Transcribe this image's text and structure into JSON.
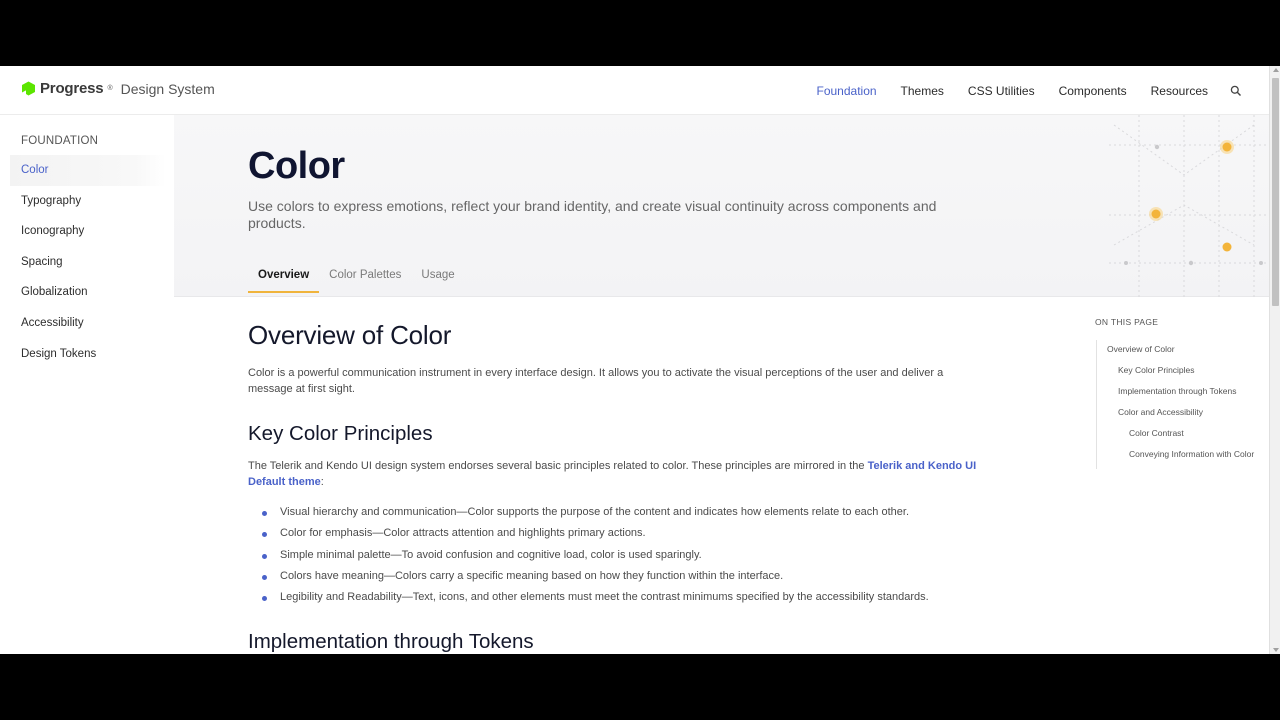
{
  "header": {
    "brand_name": "Progress",
    "brand_reg": "®",
    "brand_sub": "Design System",
    "nav": [
      "Foundation",
      "Themes",
      "CSS Utilities",
      "Components",
      "Resources"
    ],
    "active_nav": "Foundation",
    "search_icon": "search-icon"
  },
  "sidebar": {
    "heading": "FOUNDATION",
    "items": [
      "Color",
      "Typography",
      "Iconography",
      "Spacing",
      "Globalization",
      "Accessibility",
      "Design Tokens"
    ],
    "active_item": "Color"
  },
  "hero": {
    "title": "Color",
    "subtitle": "Use colors to express emotions, reflect your brand identity, and create visual continuity across components and products.",
    "tabs": [
      "Overview",
      "Color Palettes",
      "Usage"
    ],
    "active_tab": "Overview"
  },
  "content": {
    "h1": "Overview of Color",
    "intro": "Color is a powerful communication instrument in every interface design. It allows you to activate the visual perceptions of the user and deliver a message at first sight.",
    "section1_title": "Key Color Principles",
    "section1_text_before": "The Telerik and Kendo UI design system endorses several basic principles related to color. These principles are mirrored in the ",
    "section1_link": "Telerik and Kendo UI Default theme",
    "section1_text_after": ":",
    "principles": [
      "Visual hierarchy and communication—Color supports the purpose of the content and indicates how elements relate to each other.",
      "Color for emphasis—Color attracts attention and highlights primary actions.",
      "Simple minimal palette—To avoid confusion and cognitive load, color is used sparingly.",
      "Colors have meaning—Colors carry a specific meaning based on how they function within the interface.",
      "Legibility and Readability—Text, icons, and other elements must meet the contrast minimums specified by the accessibility standards."
    ],
    "section2_title": "Implementation through Tokens"
  },
  "toc": {
    "title": "ON THIS PAGE",
    "items": [
      {
        "label": "Overview of Color",
        "level": 1
      },
      {
        "label": "Key Color Principles",
        "level": 2
      },
      {
        "label": "Implementation through Tokens",
        "level": 2
      },
      {
        "label": "Color and Accessibility",
        "level": 2
      },
      {
        "label": "Color Contrast",
        "level": 3
      },
      {
        "label": "Conveying Information with Color",
        "level": 3
      }
    ]
  },
  "colors": {
    "accent": "#4a62c9",
    "tab_underline": "#f0b43c",
    "brand_green": "#5ce500",
    "title_dark": "#101531"
  }
}
